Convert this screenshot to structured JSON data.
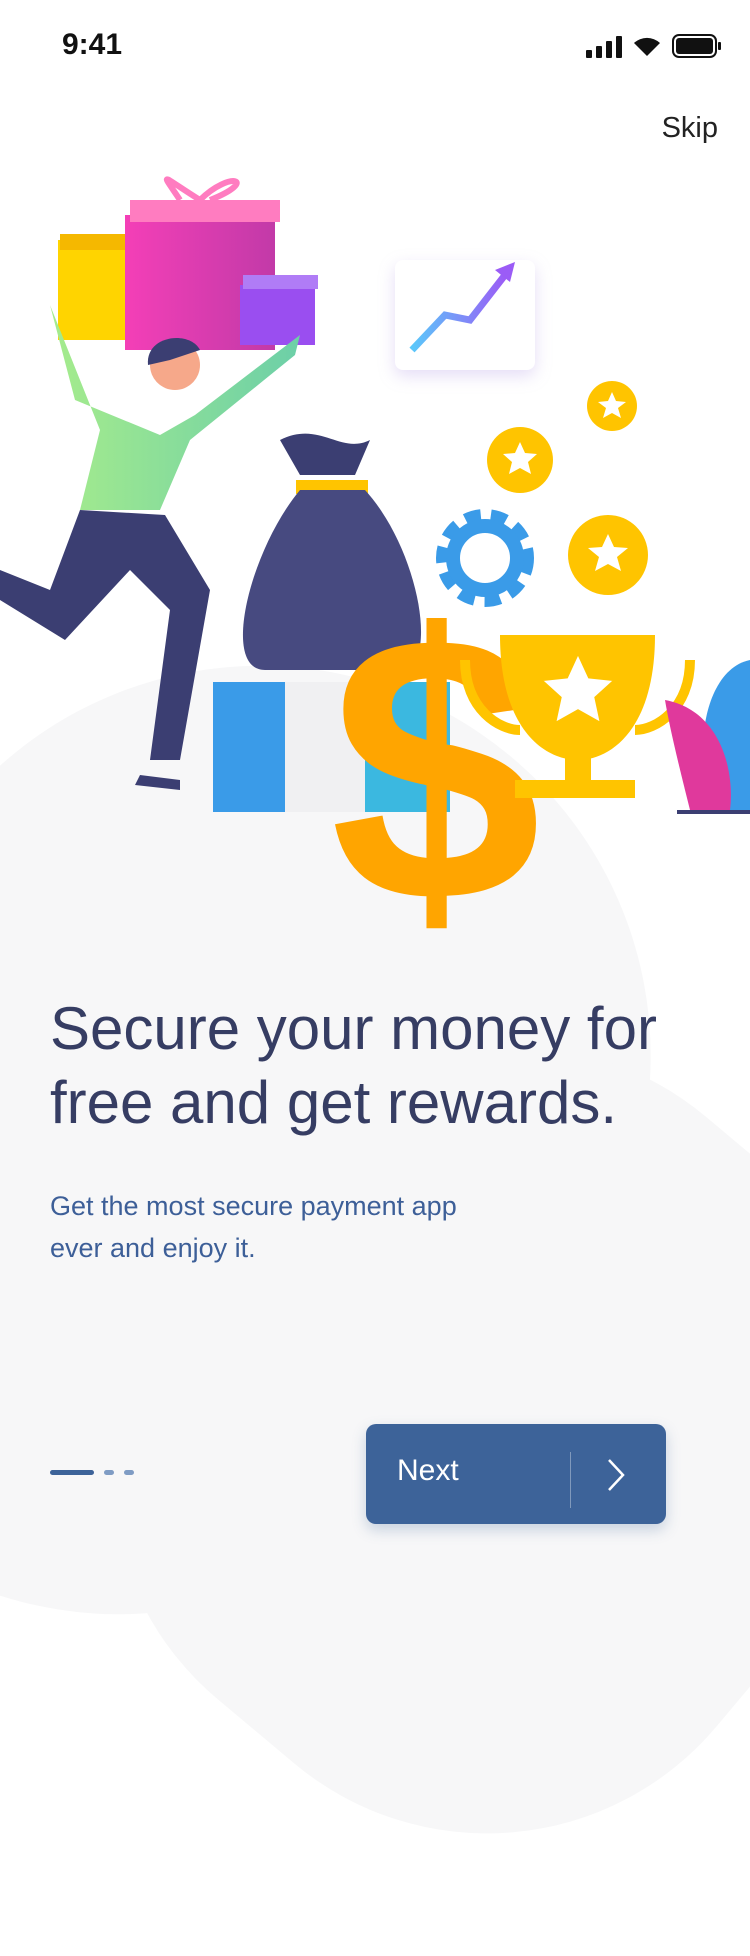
{
  "status_bar": {
    "time": "9:41"
  },
  "header": {
    "skip_label": "Skip"
  },
  "content": {
    "title": "Secure your money for free and get rewards.",
    "subtitle": "Get the most secure payment app ever and enjoy it."
  },
  "pager": {
    "current_page": 1,
    "total_pages": 3
  },
  "footer": {
    "next_label": "Next"
  },
  "colors": {
    "primary": "#3d6399",
    "title": "#363d63",
    "subtitle": "#3d5f98"
  }
}
